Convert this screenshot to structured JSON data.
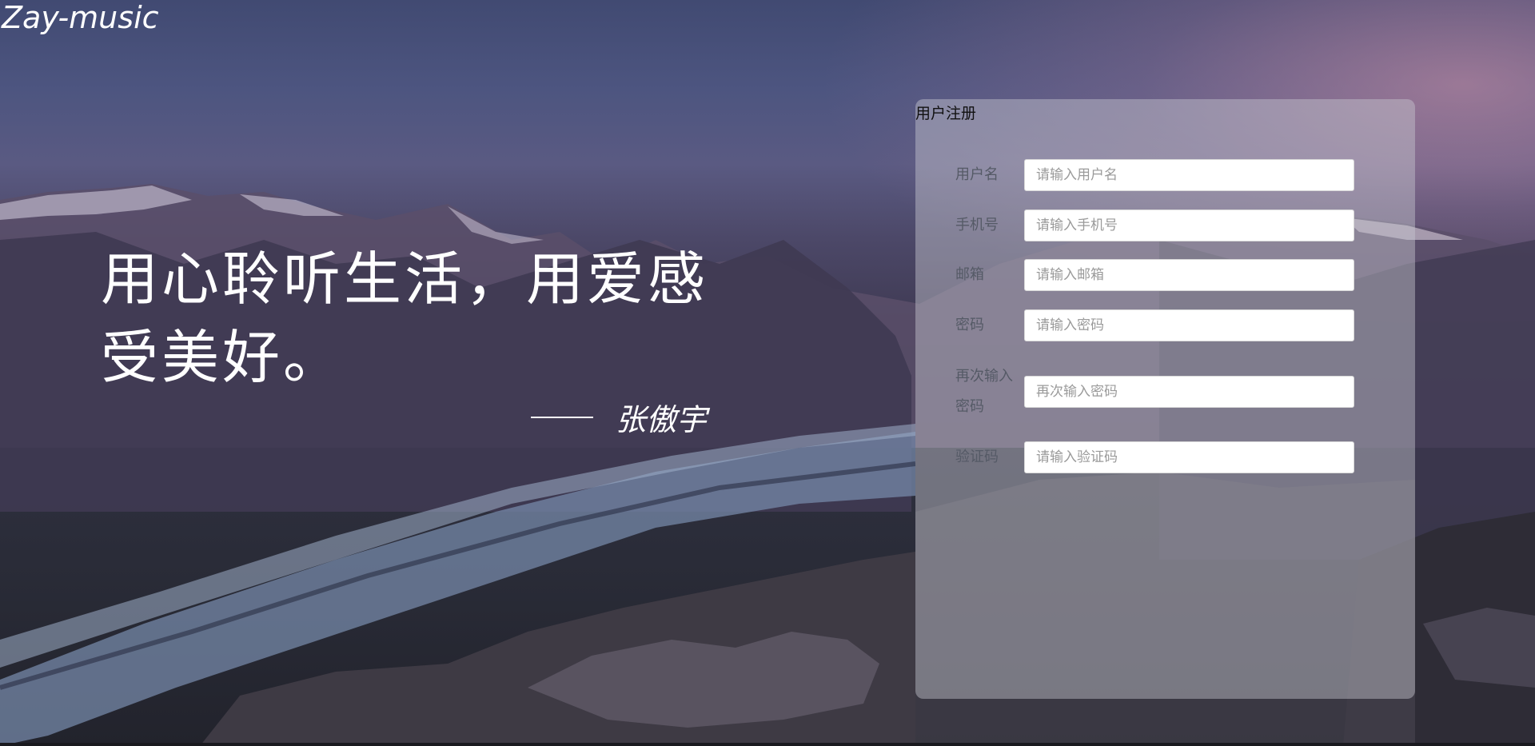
{
  "brand": {
    "name": "Zay-music"
  },
  "hero": {
    "slogan": "用心聆听生活，用爱感受美好。",
    "author": "张傲宇"
  },
  "register": {
    "title": "用户注册",
    "fields": [
      {
        "label": "用户名",
        "placeholder": "请输入用户名"
      },
      {
        "label": "手机号",
        "placeholder": "请输入手机号"
      },
      {
        "label": "邮箱",
        "placeholder": "请输入邮箱"
      },
      {
        "label": "密码",
        "placeholder": "请输入密码"
      },
      {
        "label": "再次输入密码",
        "placeholder": "再次输入密码"
      },
      {
        "label": "验证码",
        "placeholder": "请输入验证码"
      }
    ]
  }
}
